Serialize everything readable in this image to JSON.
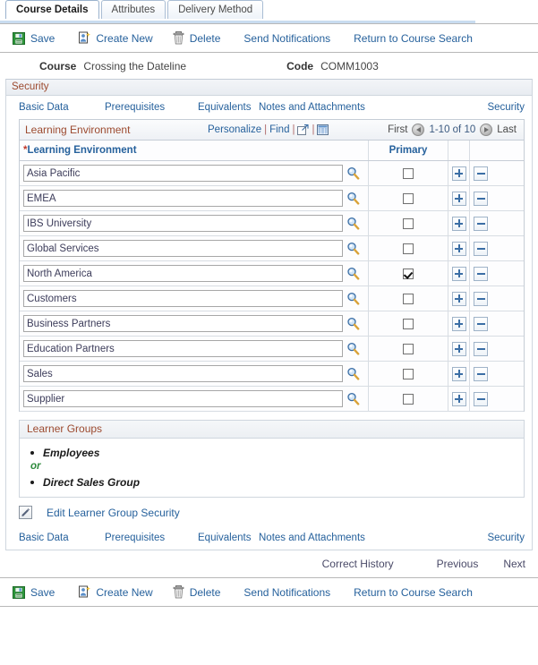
{
  "tabs": [
    {
      "label": "Course Details",
      "active": true
    },
    {
      "label": "Attributes",
      "active": false
    },
    {
      "label": "Delivery Method",
      "active": false
    }
  ],
  "toolbar": {
    "save_label": "Save",
    "create_new_label": "Create New",
    "delete_label": "Delete",
    "send_notifications_label": "Send Notifications",
    "return_label": "Return to Course Search"
  },
  "course": {
    "course_label": "Course",
    "course_value": "Crossing the Dateline",
    "code_label": "Code",
    "code_value": "COMM1003"
  },
  "section": {
    "title": "Security"
  },
  "navlinks": {
    "basic_data": "Basic Data",
    "prerequisites": "Prerequisites",
    "equivalents": "Equivalents",
    "notes": "Notes and Attachments",
    "security": "Security"
  },
  "grid": {
    "title": "Learning Environment",
    "personalize": "Personalize",
    "find": "Find",
    "sep": "|",
    "first_label": "First",
    "last_label": "Last",
    "range": "1-10 of 10",
    "col_name": "Learning Environment",
    "col_name_required": "*",
    "col_primary": "Primary",
    "rows": [
      {
        "name": "Asia Pacific",
        "primary": false
      },
      {
        "name": "EMEA",
        "primary": false
      },
      {
        "name": "IBS University",
        "primary": false
      },
      {
        "name": "Global Services",
        "primary": false
      },
      {
        "name": "North America",
        "primary": true
      },
      {
        "name": "Customers",
        "primary": false
      },
      {
        "name": "Business Partners",
        "primary": false
      },
      {
        "name": "Education Partners",
        "primary": false
      },
      {
        "name": "Sales",
        "primary": false
      },
      {
        "name": "Supplier",
        "primary": false
      }
    ]
  },
  "learner_groups": {
    "title": "Learner Groups",
    "items": [
      "Employees",
      "Direct Sales Group"
    ],
    "conjunction": "or",
    "edit_link": "Edit Learner Group Security"
  },
  "history": {
    "correct_history": "Correct History",
    "previous": "Previous",
    "next": "Next"
  },
  "colors": {
    "link": "#26619c",
    "section_header": "#9c4a2f",
    "required_star": "#c0392b",
    "conjunction": "#2e8b3d",
    "save_icon": "#2d9c3c"
  }
}
